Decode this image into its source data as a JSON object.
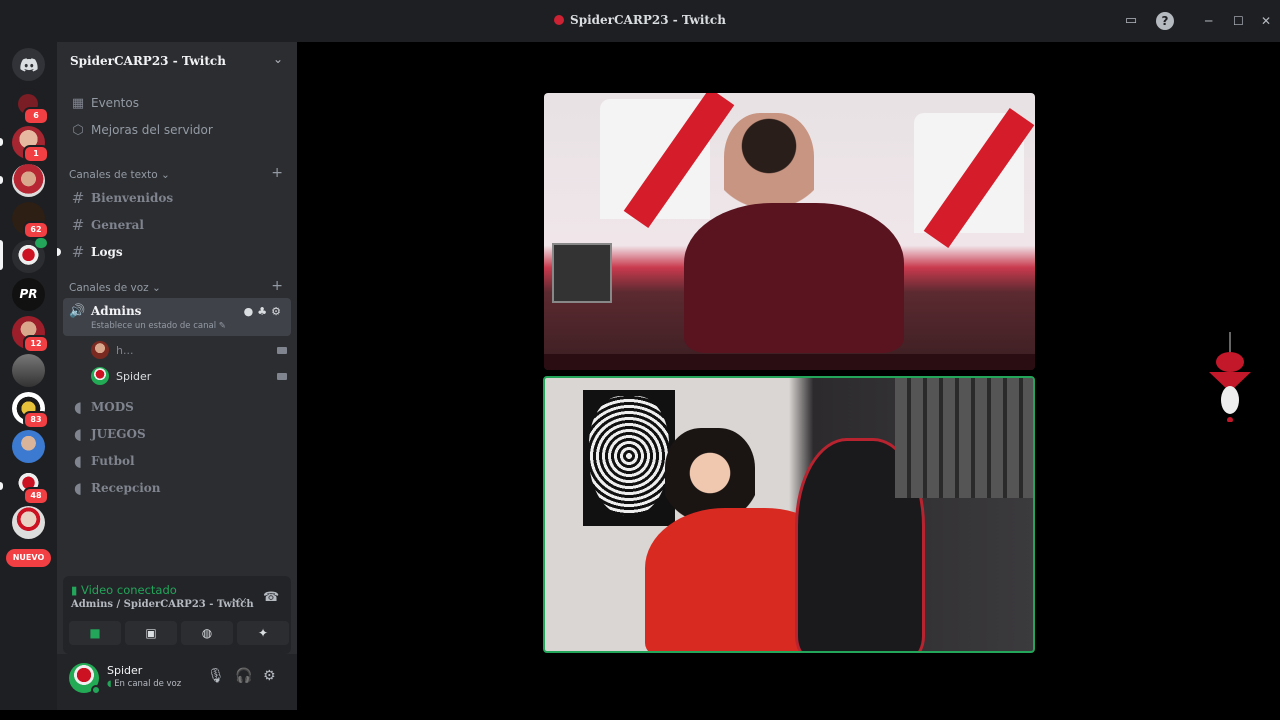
{
  "window": {
    "title": "SpiderCARP23 - Twitch",
    "minimize_glyph": "─",
    "maximize_glyph": "☐",
    "close_glyph": "✕",
    "help_glyph": "?"
  },
  "guilds": {
    "badges": [
      "6",
      "1",
      "62",
      "12",
      "83",
      "48"
    ],
    "pr_label": "PR",
    "new_label": "NUEVO"
  },
  "server": {
    "name": "SpiderCARP23 - Twitch"
  },
  "nav": {
    "events": "Eventos",
    "boosts": "Mejoras del servidor"
  },
  "text_category": {
    "label": "Canales de texto",
    "channels": [
      "Bienvenidos",
      "General",
      "Logs"
    ]
  },
  "voice_category": {
    "label": "Canales de voz",
    "active_channel": "Admins",
    "active_status": "Establece un estado de canal",
    "members": [
      "h...",
      "Spider"
    ],
    "channels": [
      "MODS",
      "JUEGOS",
      "Futbol",
      "Recepcion"
    ]
  },
  "voice_panel": {
    "connected_label": "Video conectado",
    "channel_path": "Admins / SpiderCARP23 - Twitch"
  },
  "user": {
    "name": "Spider",
    "status": "En canal de voz"
  },
  "colors": {
    "accent_green": "#23a55a",
    "badge_red": "#f23f43",
    "sidebar_bg": "#2b2d31",
    "rail_bg": "#1e1f22"
  },
  "icons": [
    "discord-icon",
    "calendar-icon",
    "shield-icon",
    "hash-icon",
    "speaker-icon",
    "plus-icon",
    "chevron-down-icon",
    "camera-icon",
    "screen-share-icon",
    "gamepad-icon",
    "activity-icon",
    "signal-icon",
    "disconnect-icon",
    "mic-icon",
    "headphones-icon",
    "gear-icon",
    "help-icon"
  ]
}
